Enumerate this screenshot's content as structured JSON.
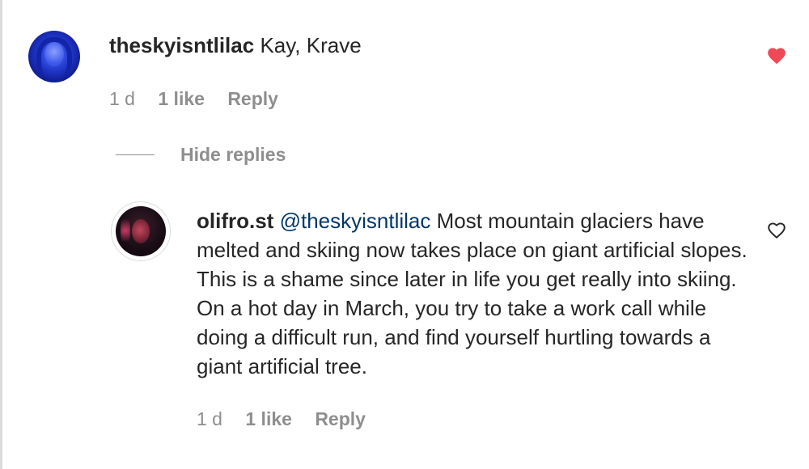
{
  "comments": [
    {
      "username": "theskyisntlilac",
      "text": "Kay, Krave",
      "time": "1 d",
      "likes": "1 like",
      "reply_label": "Reply",
      "liked": true
    },
    {
      "username": "olifro.st",
      "mention": "@theskyisntlilac",
      "text": "Most mountain glaciers have melted and skiing now takes place on giant artificial slopes. This is a shame since later in life you get really into skiing. On a hot day in March, you try to take a work call while doing a difficult run, and find yourself hurtling towards a giant artificial tree.",
      "time": "1 d",
      "likes": "1 like",
      "reply_label": "Reply",
      "liked": false
    }
  ],
  "replies_toggle": {
    "label": "Hide replies"
  },
  "colors": {
    "text": "#262626",
    "secondary": "#8e8e8e",
    "mention": "#00376b",
    "liked_heart": "#ed4956"
  },
  "icons": {
    "liked": "heart-filled-icon",
    "unliked": "heart-outline-icon"
  }
}
